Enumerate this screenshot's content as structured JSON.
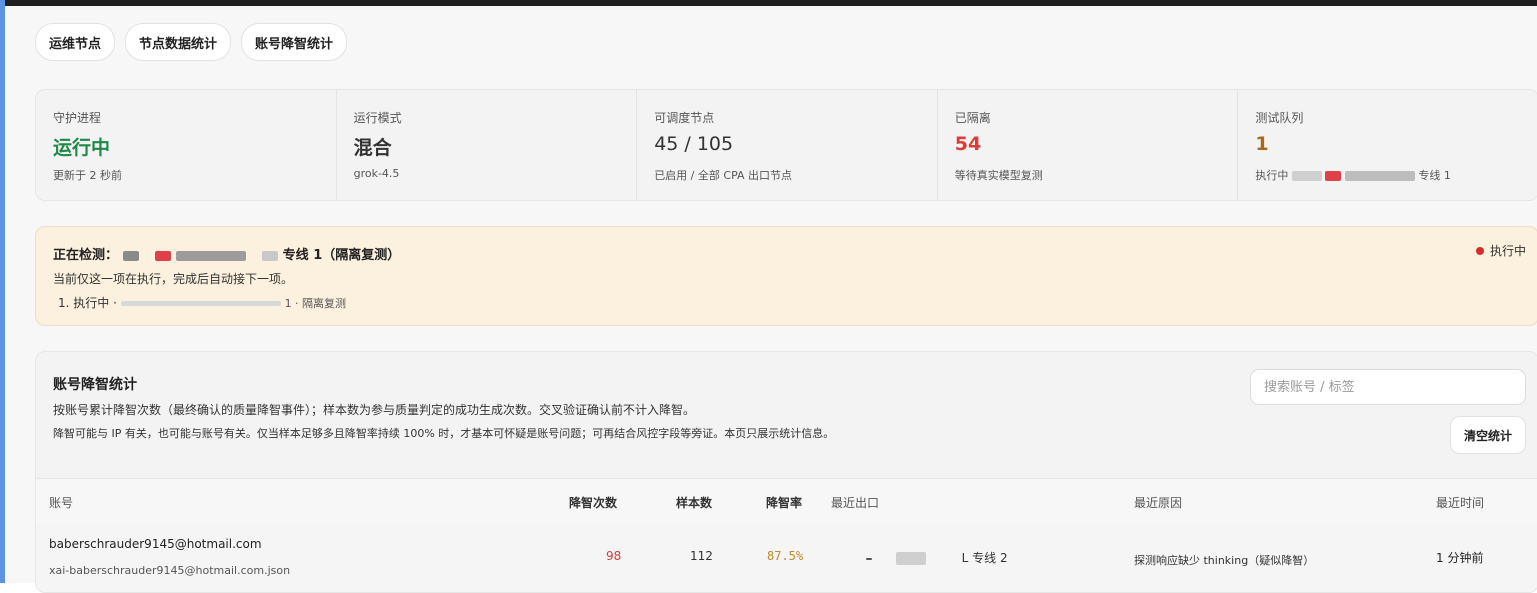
{
  "tabs": [
    "运维节点",
    "节点数据统计",
    "账号降智统计"
  ],
  "stats": [
    {
      "label": "守护进程",
      "value": "运行中",
      "sub": "更新于 2 秒前",
      "color": "#1f8a47"
    },
    {
      "label": "运行模式",
      "value": "混合",
      "sub": "grok-4.5",
      "color": "#333333"
    },
    {
      "label": "可调度节点",
      "value": "45 / 105",
      "sub": "已启用 / 全部 CPA 出口节点",
      "color": "#333333"
    },
    {
      "label": "已隔离",
      "value": "54",
      "sub": "等待真实模型复测",
      "color": "#e03a3a"
    },
    {
      "label": "测试队列",
      "value": "1",
      "sub_prefix": "执行中",
      "sub_suffix": "专线 1",
      "color": "#a56a1e"
    }
  ],
  "banner": {
    "title_prefix": "正在检测：",
    "title_suffix": "专线 1（隔离复测）",
    "line": "当前仅这一项在执行，完成后自动接下一项。",
    "item_prefix": "1. 执行中 ·",
    "item_suffix": "1 · 隔离复测",
    "status": "执行中"
  },
  "panel": {
    "title": "账号降智统计",
    "desc1": "按账号累计降智次数（最终确认的质量降智事件）；样本数为参与质量判定的成功生成次数。交叉验证确认前不计入降智。",
    "desc2": "降智可能与 IP 有关，也可能与账号有关。仅当样本足够多且降智率持续 100% 时，才基本可怀疑是账号问题；可再结合风控字段等旁证。本页只展示统计信息。",
    "search_placeholder": "搜索账号 / 标签",
    "clear_label": "清空统计"
  },
  "table": {
    "headers": {
      "account": "账号",
      "degrade_count": "降智次数",
      "samples": "样本数",
      "rate": "降智率",
      "exit": "最近出口",
      "reason": "最近原因",
      "time": "最近时间"
    },
    "rows": [
      {
        "account": "baberschrauder9145@hotmail.com",
        "file": "xai-baberschrauder9145@hotmail.com.json",
        "degrade_count": "98",
        "samples": "112",
        "rate": "87.5%",
        "exit_suffix": "L 专线 2",
        "reason": "探测响应缺少 thinking（疑似降智）",
        "time": "1 分钟前"
      }
    ]
  },
  "colors": {
    "running": "#1f8a47",
    "isolated": "#e03a3a",
    "queue": "#a56a1e",
    "rate": "#c08a2a",
    "count": "#d93b3b"
  }
}
